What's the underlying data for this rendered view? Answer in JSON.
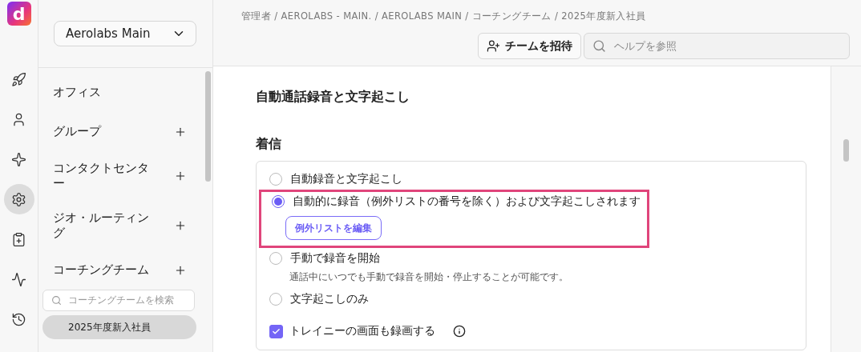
{
  "logo": {
    "letter": "d"
  },
  "rail": [
    {
      "selected": false
    },
    {
      "selected": false
    },
    {
      "selected": false
    },
    {
      "selected": true
    },
    {
      "selected": false
    },
    {
      "selected": false
    },
    {
      "selected": false
    }
  ],
  "workspace": {
    "value": "Aerolabs Main"
  },
  "nav": {
    "items": [
      {
        "label": "オフィス",
        "addable": false
      },
      {
        "label": "グループ",
        "addable": true
      },
      {
        "label": "コンタクトセンター",
        "addable": true
      },
      {
        "label": "ジオ・ルーティング",
        "addable": true
      },
      {
        "label": "コーチングチーム",
        "addable": true
      }
    ],
    "search": {
      "placeholder": "コーチングチームを検索"
    },
    "teams": [
      {
        "label": "2025年度新入社員",
        "selected": true
      }
    ]
  },
  "breadcrumb": [
    "管理者",
    "AEROLABS - MAIN.",
    "AEROLABS MAIN",
    "コーチングチーム",
    "2025年度新入社員"
  ],
  "breadcrumb_separator": "/",
  "invite_button": "チームを招待",
  "help_search": {
    "placeholder": "ヘルプを参照"
  },
  "section_title": "自動通話録音と文字起こし",
  "group_title": "着信",
  "options": [
    {
      "label": "自動録音と文字起こし",
      "selected": false,
      "highlighted": false
    },
    {
      "label": "自動的に録音（例外リストの番号を除く）および文字起こしされます",
      "selected": true,
      "highlighted": true,
      "button": "例外リストを編集"
    },
    {
      "label": "手動で録音を開始",
      "selected": false,
      "highlighted": false,
      "hint": "通話中にいつでも手動で録音を開始・停止することが可能です。"
    },
    {
      "label": "文字起こしのみ",
      "selected": false,
      "highlighted": false
    }
  ],
  "screen_recording": {
    "label": "トレイニーの画面も録画する",
    "checked": true
  }
}
